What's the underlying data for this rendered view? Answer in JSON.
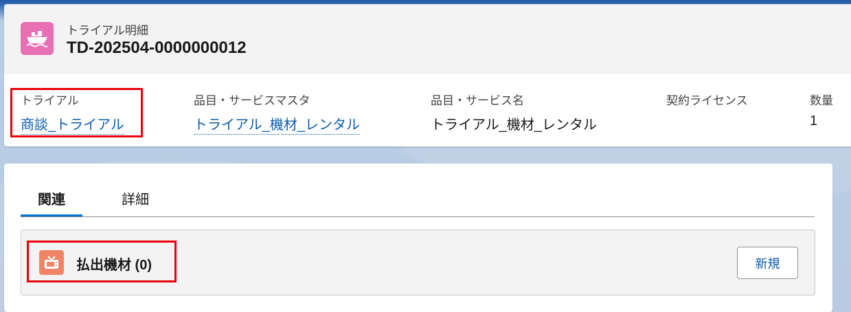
{
  "header": {
    "object_label": "トライアル明細",
    "record_title": "TD-202504-0000000012",
    "icon": "ship-icon",
    "icon_color": "#e96fb5"
  },
  "fields": [
    {
      "label": "トライアル",
      "value": "商談_トライアル",
      "is_link": true
    },
    {
      "label": "品目・サービスマスタ",
      "value": "トライアル_機材_レンタル",
      "is_link": true
    },
    {
      "label": "品目・サービス名",
      "value": "トライアル_機材_レンタル",
      "is_link": false
    },
    {
      "label": "契約ライセンス",
      "value": "",
      "is_link": false
    },
    {
      "label": "数量",
      "value": "1",
      "is_link": false
    }
  ],
  "tabs": [
    {
      "label": "関連",
      "active": true
    },
    {
      "label": "詳細",
      "active": false
    }
  ],
  "related_list": {
    "title": "払出機材 (0)",
    "icon": "tv-icon",
    "icon_color": "#f08466",
    "new_button_label": "新規"
  },
  "colors": {
    "link": "#0b5cab",
    "active_tab": "#0176d3",
    "highlight": "#e8000b"
  }
}
